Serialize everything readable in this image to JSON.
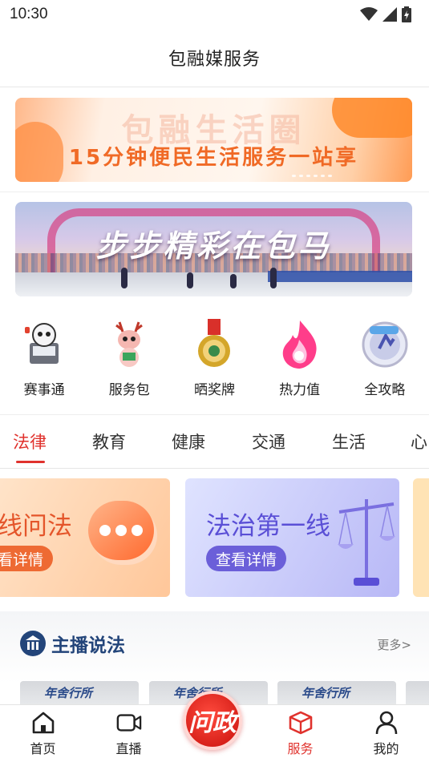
{
  "status_bar": {
    "time": "10:30"
  },
  "header": {
    "title": "包融媒服务"
  },
  "banners": [
    {
      "title": "包融生活圈",
      "subtitle": "15分钟便民生活服务一站享"
    },
    {
      "title": "步步精彩在包马"
    }
  ],
  "quick_links": [
    {
      "label": "赛事通",
      "icon": "robot-mascot-icon"
    },
    {
      "label": "服务包",
      "icon": "deer-mascot-icon"
    },
    {
      "label": "晒奖牌",
      "icon": "medal-icon"
    },
    {
      "label": "热力值",
      "icon": "flame-icon"
    },
    {
      "label": "全攻略",
      "icon": "badge-icon"
    }
  ],
  "tabs": [
    "法律",
    "教育",
    "健康",
    "交通",
    "生活",
    "心"
  ],
  "active_tab": "法律",
  "cards": [
    {
      "title": "在线问法",
      "button": "查看详情"
    },
    {
      "title": "法治第一线",
      "button": "查看详情"
    }
  ],
  "section": {
    "title": "主播说法",
    "more": "更多>"
  },
  "thumbs": [
    "年舍行所",
    "年舍行所",
    "年舍行所"
  ],
  "bottom_nav": [
    {
      "label": "首页",
      "icon": "home-icon"
    },
    {
      "label": "直播",
      "icon": "video-icon"
    },
    {
      "label": "问政",
      "icon": "center-logo"
    },
    {
      "label": "服务",
      "icon": "box-icon"
    },
    {
      "label": "我的",
      "icon": "user-icon"
    }
  ],
  "colors": {
    "accent": "#e0322d",
    "orange": "#f06a26",
    "purple": "#5a4fd6",
    "navy": "#23457a"
  }
}
